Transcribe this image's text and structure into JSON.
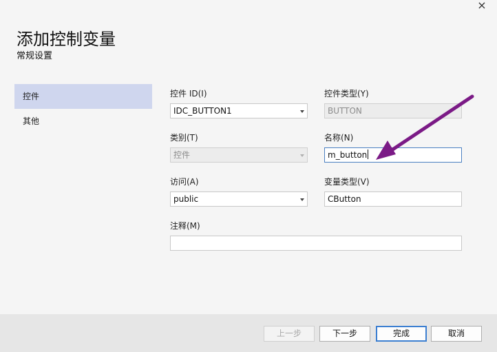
{
  "dialog": {
    "close_glyph": "×",
    "title": "添加控制变量",
    "subtitle": "常规设置"
  },
  "nav": {
    "items": [
      {
        "label": "控件",
        "active": true
      },
      {
        "label": "其他",
        "active": false
      }
    ]
  },
  "form": {
    "control_id": {
      "label": "控件 ID(I)",
      "value": "IDC_BUTTON1"
    },
    "control_type": {
      "label": "控件类型(Y)",
      "value": "BUTTON"
    },
    "category": {
      "label": "类别(T)",
      "value": "控件"
    },
    "name": {
      "label": "名称(N)",
      "value": "m_button"
    },
    "access": {
      "label": "访问(A)",
      "value": "public"
    },
    "variable_type": {
      "label": "变量类型(V)",
      "value": "CButton"
    },
    "comment": {
      "label": "注释(M)",
      "value": ""
    }
  },
  "buttons": {
    "prev": "上一步",
    "next": "下一步",
    "finish": "完成",
    "cancel": "取消"
  },
  "colors": {
    "annotation_arrow": "#7b1a86",
    "nav_active": "#cfd6ee",
    "focus_border": "#4a7fc1"
  },
  "icons": [
    "close-icon",
    "dropdown-arrow-icon",
    "annotation-arrow"
  ]
}
